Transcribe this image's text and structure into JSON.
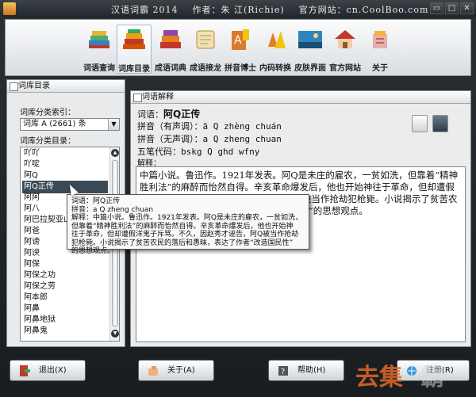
{
  "window": {
    "title": "汉语词霸 2014    作者：朱 江(Richie)    官方网站：cn.CoolBoo.com",
    "minimize": "▭",
    "maximize": "□",
    "close": "✕"
  },
  "toolbar": {
    "items": [
      {
        "label": "词语查询",
        "icon": "books-icon"
      },
      {
        "label": "词库目录",
        "icon": "book-stack-icon"
      },
      {
        "label": "成语词典",
        "icon": "dictionary-icon"
      },
      {
        "label": "成语接龙",
        "icon": "scroll-icon"
      },
      {
        "label": "拼音博士",
        "icon": "pinyin-icon"
      },
      {
        "label": "内码转换",
        "icon": "convert-icon"
      },
      {
        "label": "皮肤界面",
        "icon": "skin-icon"
      },
      {
        "label": "官方网站",
        "icon": "website-icon"
      },
      {
        "label": "关于",
        "icon": "about-icon"
      }
    ],
    "active_index": 1
  },
  "left_panel": {
    "header": "词库目录",
    "index_label": "词库分类索引：",
    "index_value": "词库 A (2661) 条",
    "catalog_label": "词库分类目录：",
    "items": [
      "吖吖",
      "吖啶",
      "阿Q",
      "阿Q正传",
      "阿阿",
      "阿八",
      "阿巴拉契亚山",
      "阿爸",
      "阿谤",
      "阿谀",
      "阿保",
      "阿保之功",
      "阿保之劳",
      "阿本郎",
      "阿鼻",
      "阿鼻地狱",
      "阿鼻鬼"
    ],
    "selected_index": 3
  },
  "right_panel": {
    "header": "词语解释",
    "word_label": "词语：",
    "word": "阿Q正传",
    "pinyin_tone_label": "拼音（有声调）：",
    "pinyin_tone": "ā Q zhèng chuán",
    "pinyin_plain_label": "拼音（无声调）：",
    "pinyin_plain": "a Q zheng chuan",
    "wubi_label": "五笔代码：",
    "wubi": "bskg Q ghd wfny",
    "explain_label": "解释：",
    "explanation": "中篇小说。鲁迅作。1921年发表。阿Q是未庄的雇农，一贫如洗，但靠着“精神胜利法”的麻醉而怡然自得。辛亥革命爆发后，他也开始神往于革命，但却遭假洋鬼子斥骂。不久，因赵秀才诬告，阿Q被当作抢劫犯枪毙。小说揭示了贫苦农民的落后和愚昧，表达了作者“改造国民性”的思想观点。"
  },
  "tooltip": {
    "line1": "词语：阿Q正传",
    "line2": "拼音：a Q zheng chuan",
    "line3": "解释：中篇小说。鲁迅作。1921年发表。阿Q是未庄的雇农，一贫如洗，",
    "line4": "但靠着“精神胜利法”的麻醉而怡然自得。辛亥革命爆发后，他也开始神",
    "line5": "往于革命，但却遭假洋鬼子斥骂。不久，因赵秀才诬告，阿Q被当作抢劫",
    "line6": "犯枪毙。小说揭示了贫苦农民的落后和愚昧，表达了作者“改造国民性”",
    "line7": "的思想观点。"
  },
  "buttons": {
    "exit": "退出(X)",
    "about": "关于(A)",
    "help": "帮助(H)",
    "register": "注册(R)"
  },
  "colors": {
    "frame": "#1e2226",
    "selected": "#3b4a57",
    "toolbar_bg": "#e8ecef"
  }
}
